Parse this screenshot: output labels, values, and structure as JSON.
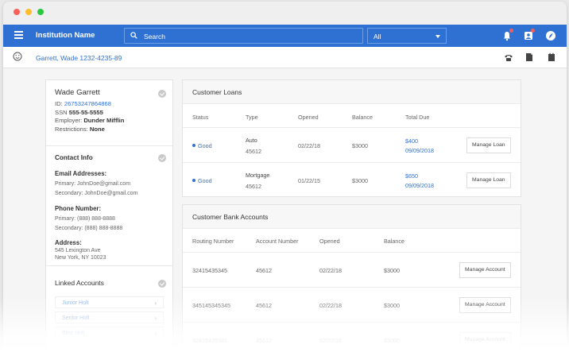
{
  "topbar": {
    "institution_name": "Institution Name",
    "search_placeholder": "Search",
    "select_value": "All"
  },
  "subbar": {
    "customer": "Garrett, Wade  1232-4235-89"
  },
  "profile": {
    "name": "Wade Garrett",
    "id_label": "ID:",
    "id_value": "26753247864868",
    "ssn_label": "SSN",
    "ssn_value": "555-55-5555",
    "employer_label": "Employer:",
    "employer_value": "Dunder Mifflin",
    "restrictions_label": "Restrictions:",
    "restrictions_value": "None"
  },
  "contact": {
    "title": "Contact Info",
    "email_heading": "Email Addresses:",
    "email_primary": "Primary: JohnDoe@gmail.com",
    "email_secondary": "Secondary: JohnDoe@gmail.com",
    "phone_heading": "Phone Number:",
    "phone_primary": "Primary: (888) 888-8888",
    "phone_secondary": "Secondary: (888) 888-8888",
    "address_heading": "Address:",
    "address_line1": "545 Lexington Ave",
    "address_line2": "New York, NY 10023"
  },
  "linked": {
    "title": "Linked Accounts",
    "items": [
      {
        "label": "Junior Holt"
      },
      {
        "label": "Senior Holt"
      },
      {
        "label": "Bust Holt"
      }
    ]
  },
  "loans": {
    "title": "Customer Loans",
    "headers": {
      "status": "Status",
      "type": "Type",
      "opened": "Opened",
      "balance": "Balance",
      "total_due": "Total Due"
    },
    "rows": [
      {
        "status": "Good",
        "type": "Auto",
        "type_id": "45612",
        "opened": "02/22/18",
        "balance": "$3000",
        "due_amount": "$400",
        "due_date": "09/09/2018",
        "action": "Manage Loan"
      },
      {
        "status": "Good",
        "type": "Mortgage",
        "type_id": "45612",
        "opened": "01/22/15",
        "balance": "$3000",
        "due_amount": "$650",
        "due_date": "09/09/2018",
        "action": "Manage Loan"
      }
    ]
  },
  "bank": {
    "title": "Customer Bank Accounts",
    "headers": {
      "routing": "Routing Number",
      "account": "Account Number",
      "opened": "Opened",
      "balance": "Balance"
    },
    "rows": [
      {
        "routing": "32415435345",
        "account": "45612",
        "opened": "02/22/18",
        "balance": "$3000",
        "action": "Manage Account"
      },
      {
        "routing": "345145345345",
        "account": "45612",
        "opened": "02/22/18",
        "balance": "$3000",
        "action": "Manage Account"
      },
      {
        "routing": "32415435345",
        "account": "45612",
        "opened": "02/22/18",
        "balance": "$3000",
        "action": "Manage Account"
      }
    ]
  },
  "colors": {
    "brand": "#2f71d2",
    "badge": "#f25f5c"
  }
}
